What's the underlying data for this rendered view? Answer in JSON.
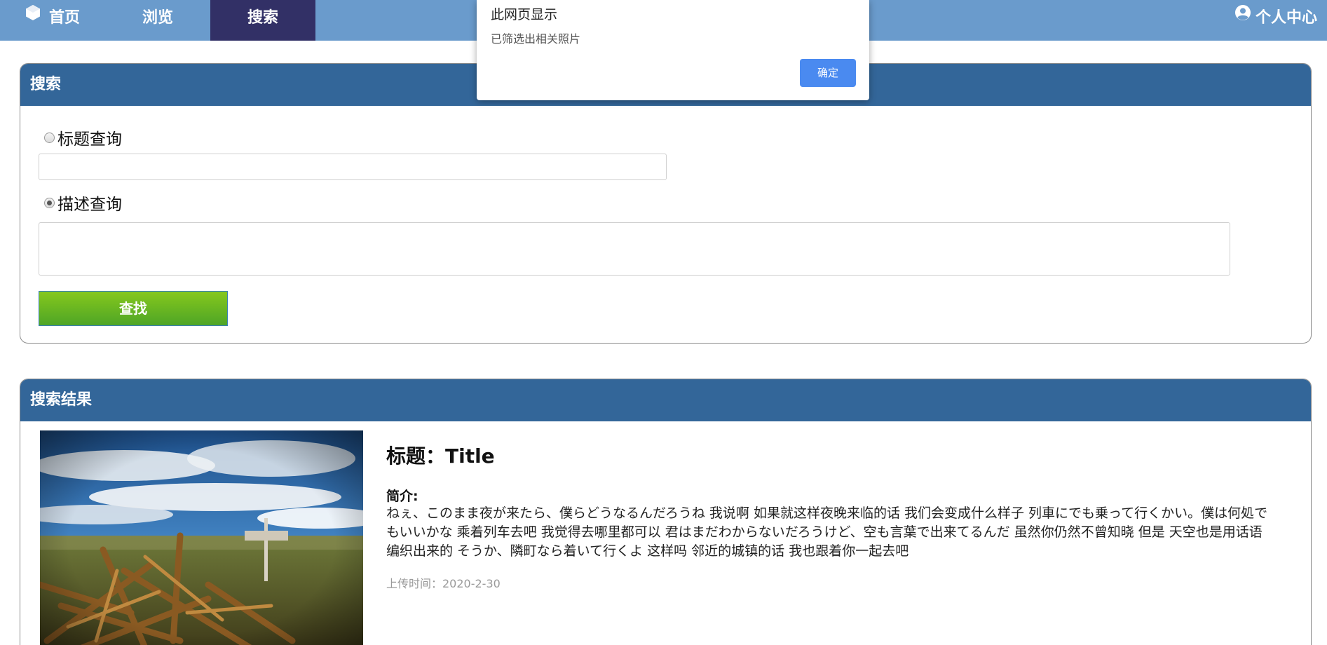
{
  "nav": {
    "home": "首页",
    "browse": "浏览",
    "search": "搜索",
    "user": "个人中心",
    "home_icon": "hexagon-logo-icon",
    "user_icon": "user-circle-icon",
    "bg_color": "#6a9bcc",
    "active_color": "#323066"
  },
  "search_panel": {
    "title": "搜索",
    "title_query_label": "标题查询",
    "title_query_value": "",
    "desc_query_label": "描述查询",
    "desc_query_value": "",
    "selected": "描述查询",
    "find_button": "查找"
  },
  "result_panel": {
    "title": "搜索结果",
    "items": [
      {
        "title": "标题：Title",
        "desc_label": "简介:",
        "desc": "ねぇ、このまま夜が来たら、僕らどうなるんだろうね 我说啊 如果就这样夜晚来临的话 我们会变成什么样子 列車にでも乗って行くかい。僕は何処でもいいかな 乘着列车去吧 我觉得去哪里都可以 君はまだわからないだろうけど、空も言葉で出来てるんだ 虽然你仍然不曾知晓 但是 天空也是用话语编织出来的 そうか、隣町なら着いて行くよ 这样吗 邻近的城镇的话 我也跟着你一起去吧",
        "upload_time": "上传时间：2020-2-30"
      }
    ]
  },
  "dialog": {
    "title": "此网页显示",
    "message": "已筛选出相关照片",
    "ok": "确定"
  },
  "colors": {
    "panel_header": "#336699",
    "find_button": "#5fb023",
    "dialog_button": "#4a8af0"
  }
}
